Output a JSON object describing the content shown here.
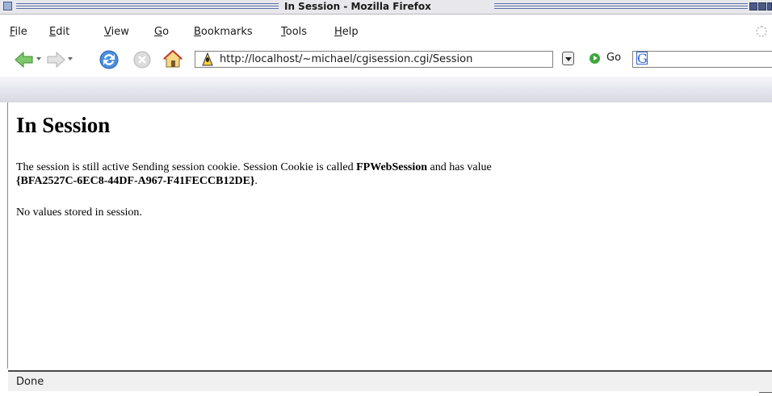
{
  "window": {
    "title": "In Session - Mozilla Firefox"
  },
  "menu": {
    "items": [
      {
        "label": "File",
        "accel": "F",
        "rest": "ile"
      },
      {
        "label": "Edit",
        "accel": "E",
        "rest": "dit"
      },
      {
        "label": "View",
        "accel": "V",
        "rest": "iew"
      },
      {
        "label": "Go",
        "accel": "G",
        "rest": "o"
      },
      {
        "label": "Bookmarks",
        "accel": "B",
        "rest": "ookmarks"
      },
      {
        "label": "Tools",
        "accel": "T",
        "rest": "ools"
      },
      {
        "label": "Help",
        "accel": "H",
        "rest": "elp"
      }
    ]
  },
  "nav": {
    "url": "http://localhost/~michael/cgisession.cgi/Session",
    "go_label": "Go",
    "search_engine_icon": "G"
  },
  "page": {
    "heading": "In Session",
    "para1_text1": "The session is still active Sending session cookie. Session Cookie is called ",
    "cookie_name": "FPWebSession",
    "para1_text2": " and has value",
    "cookie_value": "{BFA2527C-6EC8-44DF-A967-F41FECCB12DE}",
    "para1_text3": ".",
    "para2": "No values stored in session."
  },
  "status": {
    "text": "Done"
  },
  "icons": {
    "back": "back-arrow-icon",
    "forward": "forward-arrow-icon",
    "reload": "reload-icon",
    "stop": "stop-icon",
    "home": "home-icon"
  },
  "colors": {
    "accent": "#5a6fa8",
    "back_green": "#5cb85c",
    "reload_blue": "#3d7fd6"
  }
}
